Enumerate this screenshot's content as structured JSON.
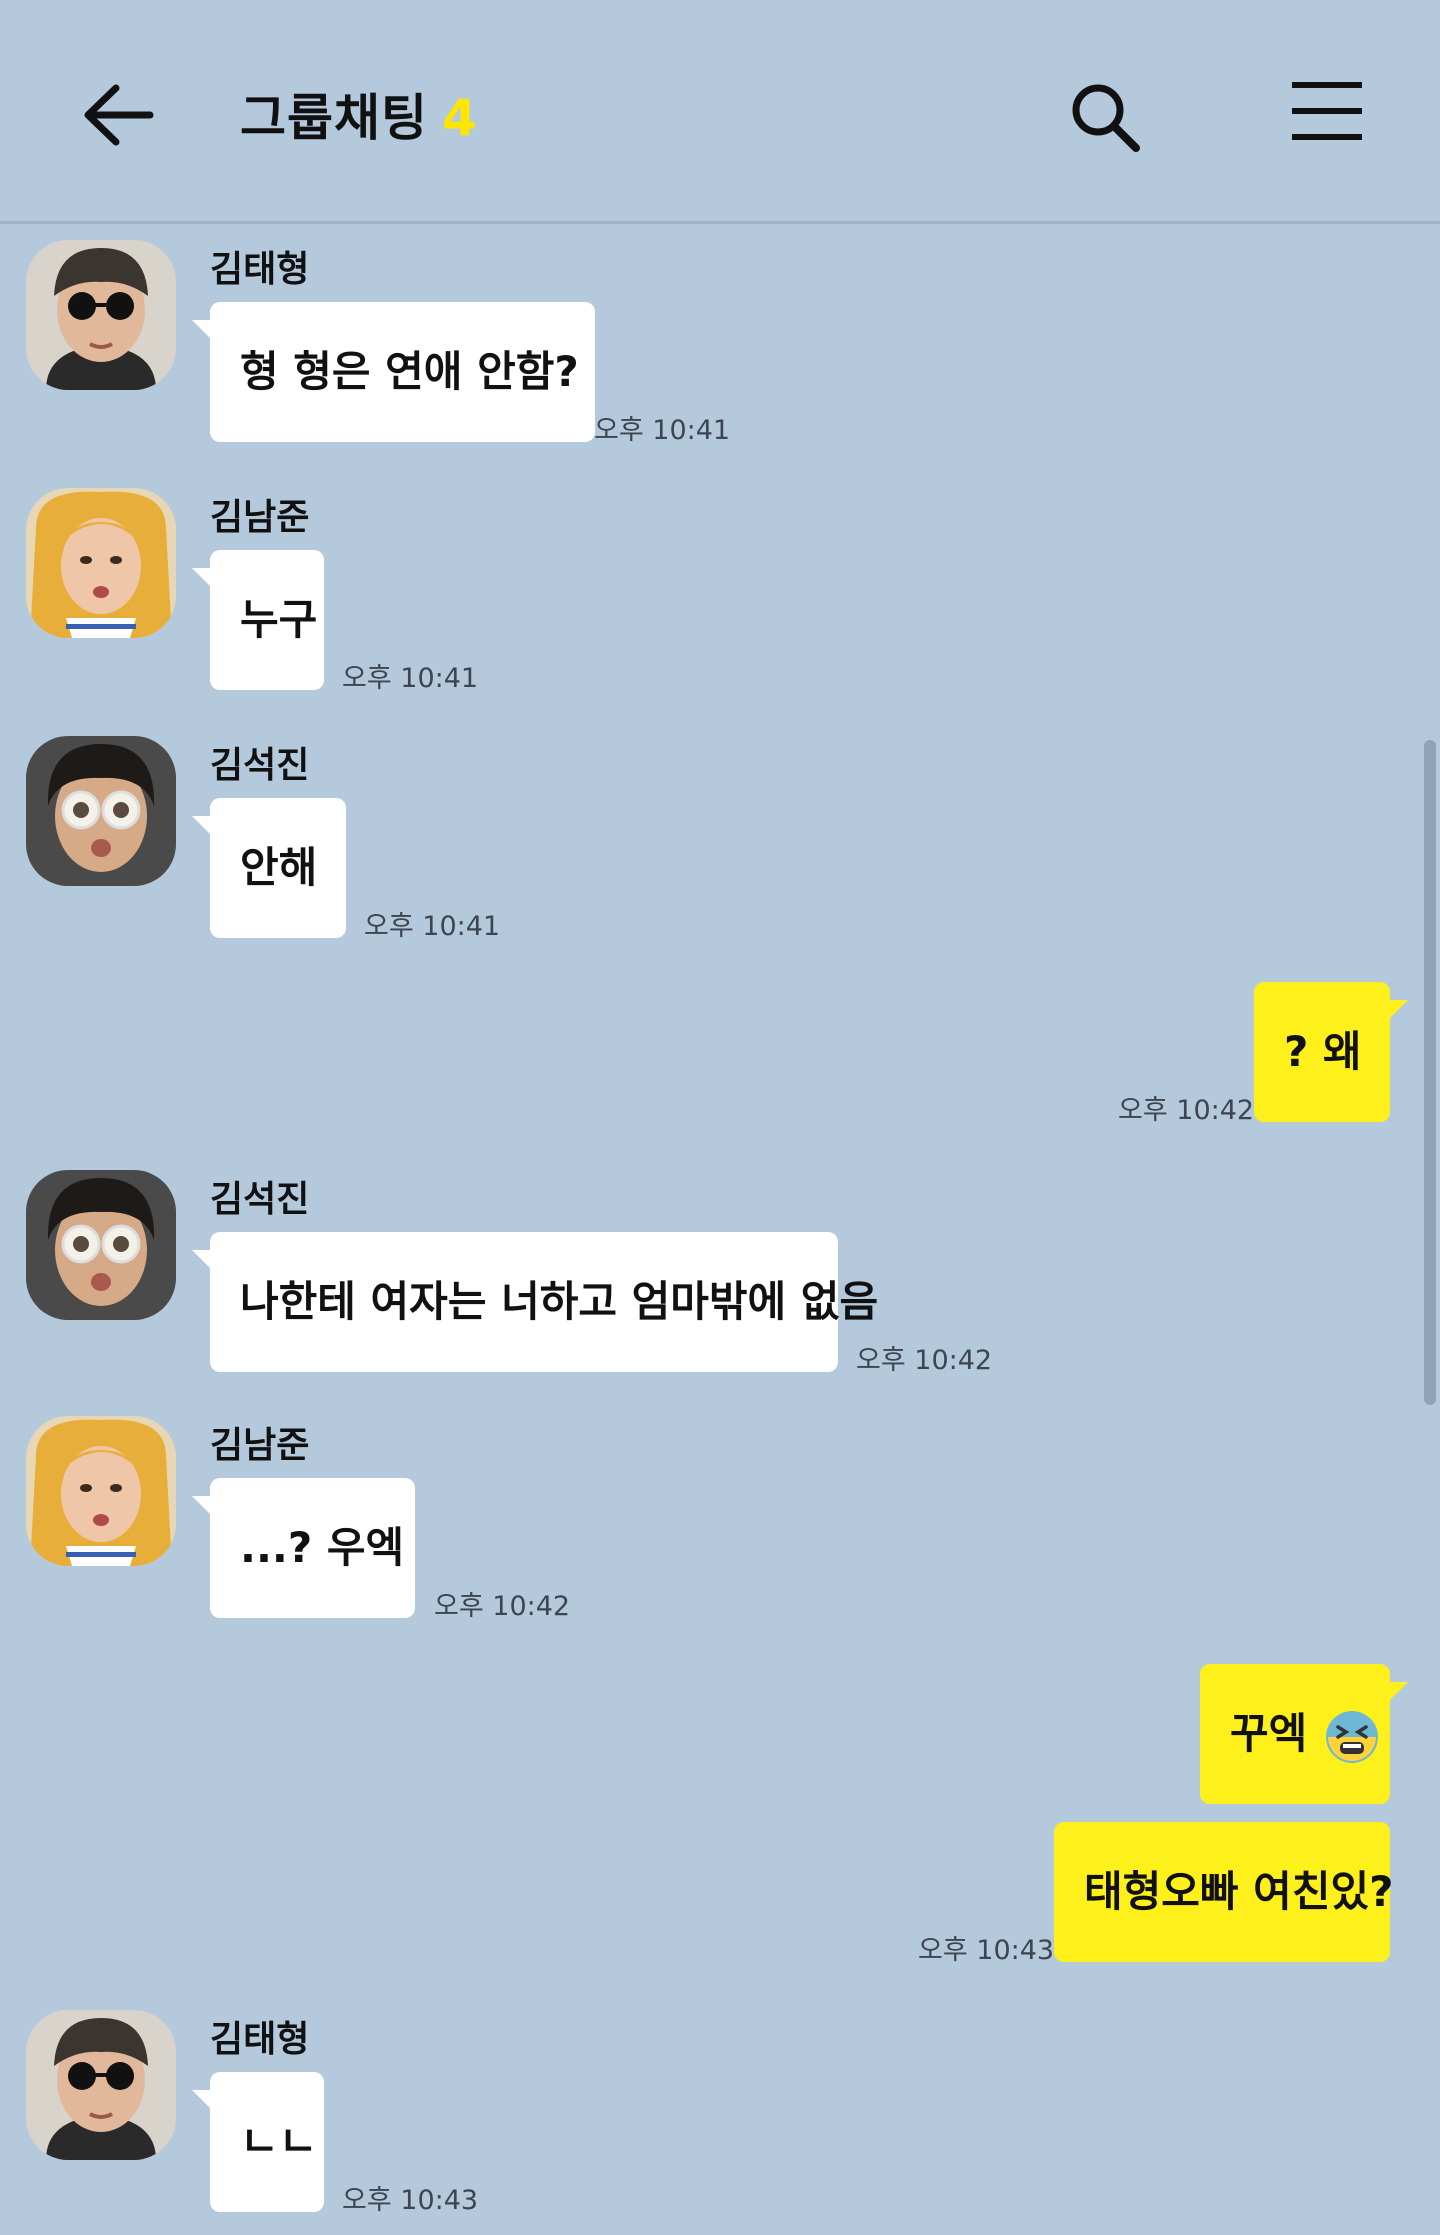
{
  "header": {
    "back_icon": "arrow-left-icon",
    "title": "그룹채팅",
    "member_count": "4",
    "search_icon": "search-icon",
    "menu_icon": "hamburger-menu-icon"
  },
  "colors": {
    "background": "#b5c9dd",
    "incoming_bubble": "#ffffff",
    "outgoing_bubble": "#fef01b",
    "count_accent": "#ffe600"
  },
  "messages": [
    {
      "sender": "김태형",
      "text": "형 형은 연애 안함?",
      "time": "오후 10:41",
      "avatar": "avatar-kim-taehyung"
    },
    {
      "sender": "김남준",
      "text": "누구",
      "time": "오후 10:41",
      "avatar": "avatar-kim-namjoon"
    },
    {
      "sender": "김석진",
      "text": "안해",
      "time": "오후 10:41",
      "avatar": "avatar-kim-seokjin"
    },
    {
      "sender": "",
      "text": "? 왜",
      "time": "오후 10:42"
    },
    {
      "sender": "김석진",
      "text": "나한테 여자는 너하고 엄마밖에 없음",
      "time": "오후 10:42",
      "avatar": "avatar-kim-seokjin"
    },
    {
      "sender": "김남준",
      "text": "...? 우엑",
      "time": "오후 10:42",
      "avatar": "avatar-kim-namjoon"
    },
    {
      "sender": "",
      "text": "꾸엑",
      "time": "",
      "emoji": "tired-face-emoji-icon"
    },
    {
      "sender": "",
      "text": "태형오빠 여친있?",
      "time": "오후 10:43"
    },
    {
      "sender": "김태형",
      "text": "ㄴㄴ",
      "time": "오후 10:43",
      "avatar": "avatar-kim-taehyung"
    }
  ]
}
